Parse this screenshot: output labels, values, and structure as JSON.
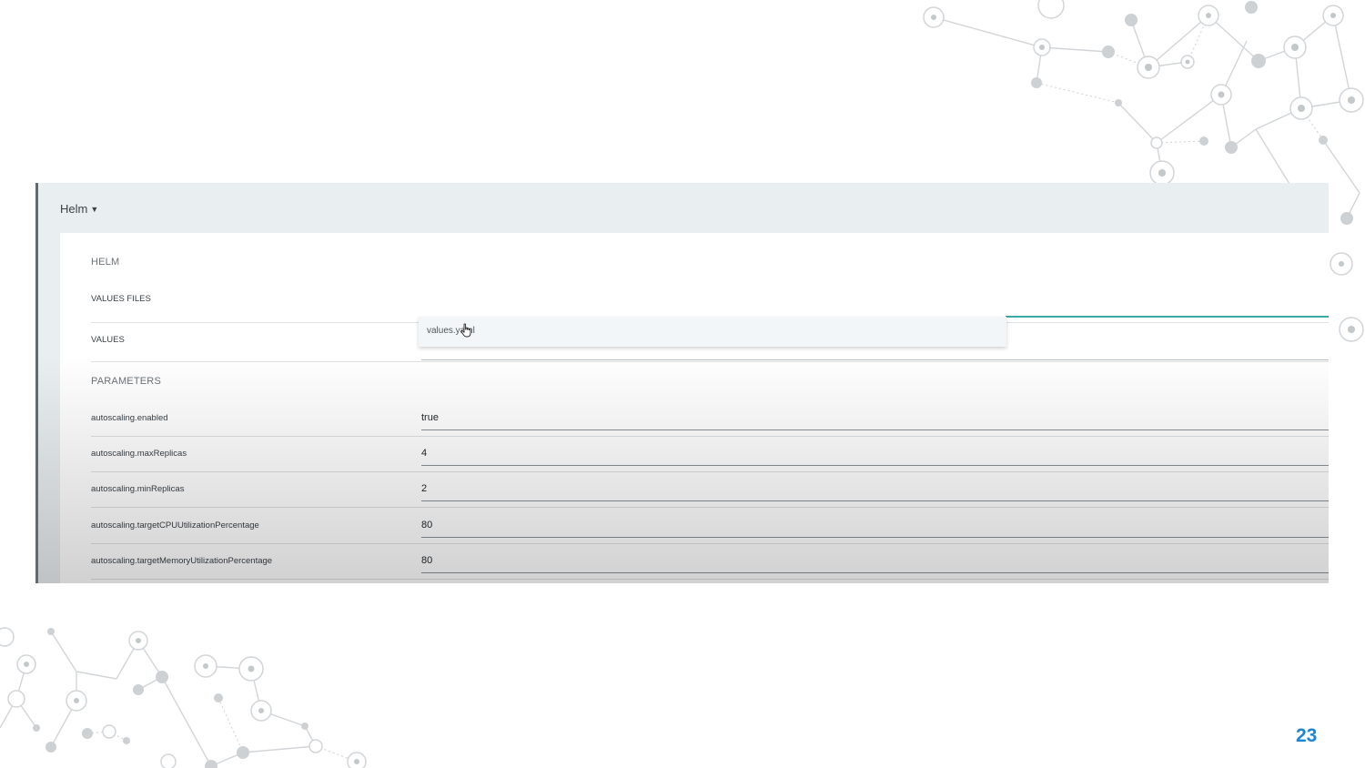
{
  "slide": {
    "page_number": "23"
  },
  "app": {
    "dropdown_label": "Helm",
    "panel": {
      "title": "HELM",
      "values_files_label": "VALUES FILES",
      "values_label": "VALUES",
      "values_files_options": [
        "values.yaml"
      ],
      "parameters_title": "PARAMETERS",
      "parameters": [
        {
          "name": "autoscaling.enabled",
          "value": "true"
        },
        {
          "name": "autoscaling.maxReplicas",
          "value": "4"
        },
        {
          "name": "autoscaling.minReplicas",
          "value": "2"
        },
        {
          "name": "autoscaling.targetCPUUtilizationPercentage",
          "value": "80"
        },
        {
          "name": "autoscaling.targetMemoryUtilizationPercentage",
          "value": "80"
        }
      ]
    }
  },
  "colors": {
    "accent_teal": "#3aa8a3",
    "page_number_blue": "#1a86d6"
  }
}
